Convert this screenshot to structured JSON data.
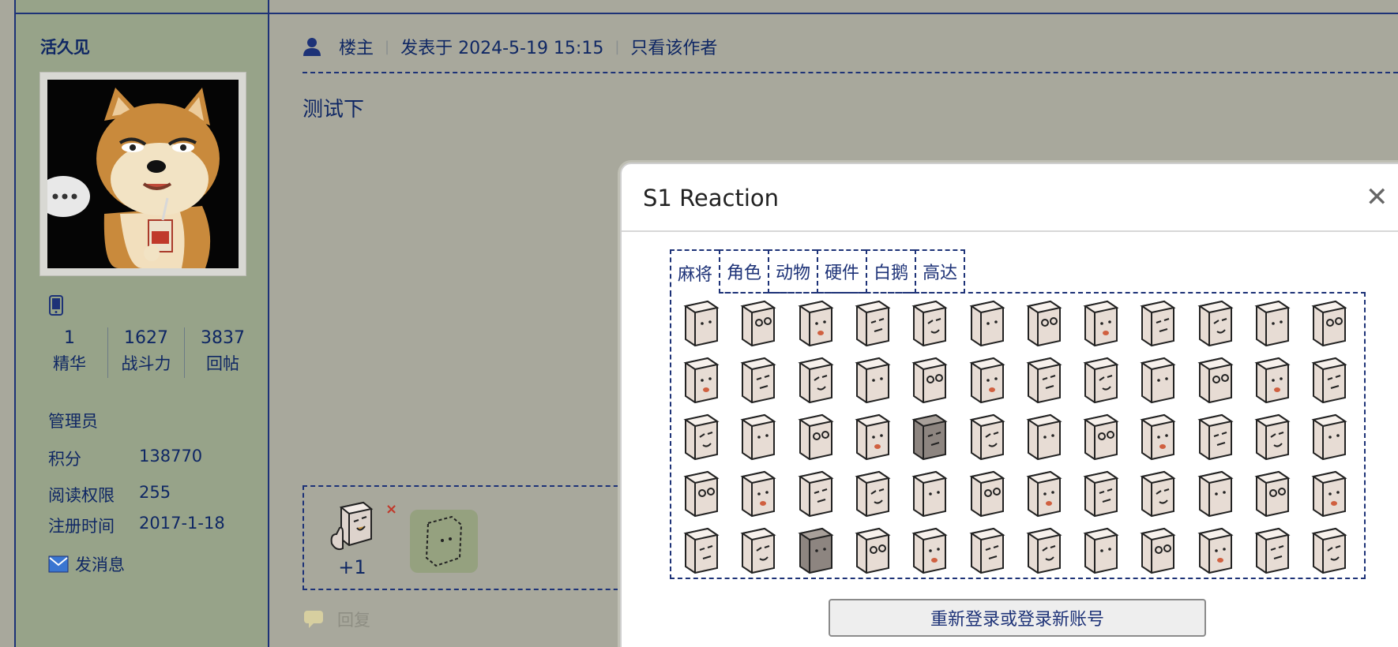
{
  "author": {
    "name": "活久见",
    "stats": [
      {
        "value": "1",
        "label": "精华"
      },
      {
        "value": "1627",
        "label": "战斗力"
      },
      {
        "value": "3837",
        "label": "回帖"
      }
    ],
    "group": "管理员",
    "info": [
      {
        "key": "积分",
        "value": "138770"
      },
      {
        "key": "阅读权限",
        "value": "255"
      },
      {
        "key": "注册时间",
        "value": "2017-1-18"
      }
    ],
    "message_label": "发消息"
  },
  "post": {
    "role": "楼主",
    "posted_at": "发表于 2024-5-19 15:15",
    "only_author": "只看该作者",
    "body": "测试下",
    "reaction_count": "+1",
    "remove_mark": "×",
    "reply_label": "回复"
  },
  "popup": {
    "title": "S1 Reaction",
    "close_symbol": "✕",
    "tabs": [
      "麻将",
      "角色",
      "动物",
      "硬件",
      "白鹅",
      "高达"
    ],
    "active_tab": 0,
    "emoji_rows": 5,
    "emoji_cols": 12,
    "relogin_label": "重新登录或登录新账号"
  },
  "colors": {
    "page_bg": "#a8a89c",
    "sidebar_bg": "#97a389",
    "link_blue": "#1d3277",
    "popup_bg": "#ffffff"
  },
  "icons": [
    "user-icon",
    "phone-icon",
    "mail-icon",
    "close-icon",
    "reply-icon",
    "add-reaction-icon"
  ]
}
